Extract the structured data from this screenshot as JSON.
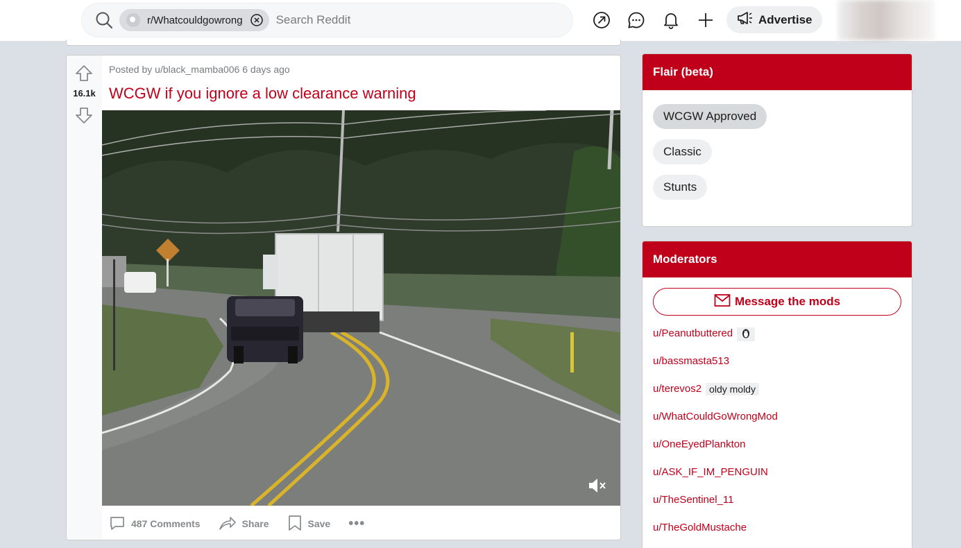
{
  "header": {
    "search_chip_label": "r/Whatcouldgowrong",
    "search_placeholder": "Search Reddit",
    "advertise_label": "Advertise"
  },
  "post": {
    "score": "16.1k",
    "meta": "Posted by u/black_mamba006 6 days ago",
    "title": "WCGW if you ignore a low clearance warning",
    "actions": {
      "comments": "487 Comments",
      "share": "Share",
      "save": "Save",
      "more": "•••"
    }
  },
  "flair_widget": {
    "title": "Flair (beta)",
    "items": [
      "WCGW Approved",
      "Classic",
      "Stunts"
    ]
  },
  "moderators_widget": {
    "title": "Moderators",
    "message_button": "Message the mods",
    "mods": [
      {
        "name": "u/Peanutbuttered",
        "flair": ""
      },
      {
        "name": "u/bassmasta513",
        "flair": ""
      },
      {
        "name": "u/terevos2",
        "flair": "oldy moldy"
      },
      {
        "name": "u/WhatCouldGoWrongMod",
        "flair": ""
      },
      {
        "name": "u/OneEyedPlankton",
        "flair": ""
      },
      {
        "name": "u/ASK_IF_IM_PENGUIN",
        "flair": ""
      },
      {
        "name": "u/TheSentinel_11",
        "flair": ""
      },
      {
        "name": "u/TheGoldMustache",
        "flair": ""
      }
    ]
  },
  "colors": {
    "accent": "#c0001a",
    "page_bg": "#dae0e6"
  }
}
